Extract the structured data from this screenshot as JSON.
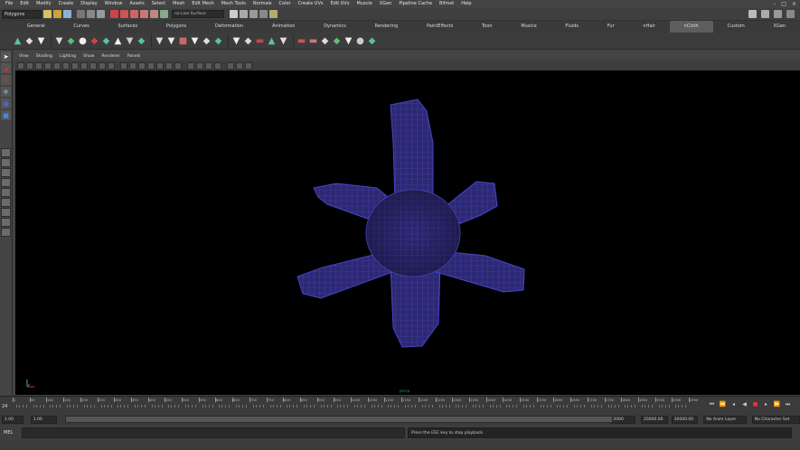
{
  "menu": {
    "items": [
      "File",
      "Edit",
      "Modify",
      "Create",
      "Display",
      "Window",
      "Assets",
      "Select",
      "Mesh",
      "Edit Mesh",
      "Mesh Tools",
      "Normals",
      "Color",
      "Create UVs",
      "Edit UVs",
      "Muscle",
      "XGen",
      "Pipeline Cache",
      "Bifrost",
      "Help"
    ],
    "window_controls": [
      "–",
      "□",
      "×"
    ]
  },
  "status_line": {
    "mode": "Polygons",
    "select_field": "no Live Surface"
  },
  "shelf_tabs": {
    "items": [
      "General",
      "Curves",
      "Surfaces",
      "Polygons",
      "Deformation",
      "Animation",
      "Dynamics",
      "Rendering",
      "PaintEffects",
      "Toon",
      "Muscle",
      "Fluids",
      "Fur",
      "nHair",
      "nCloth",
      "Custom",
      "XGen"
    ],
    "active_index": 14
  },
  "panel_menu": {
    "items": [
      "View",
      "Shading",
      "Lighting",
      "Show",
      "Renderer",
      "Panels"
    ]
  },
  "viewport": {
    "camera_label": "persp",
    "background_color": "#000000",
    "mesh_color": "#3a2f86"
  },
  "time_slider": {
    "current_frame": "24",
    "tick_labels": [
      "1",
      "50",
      "100",
      "150",
      "200",
      "250",
      "300",
      "350",
      "400",
      "450",
      "500",
      "550",
      "600",
      "650",
      "700",
      "750",
      "800",
      "850",
      "900",
      "950",
      "1000",
      "1050",
      "1100",
      "1150",
      "1200",
      "1250",
      "1300",
      "1350",
      "1400",
      "1450",
      "1500",
      "1550",
      "1600",
      "1650",
      "1700",
      "1750",
      "1800",
      "1850",
      "1900",
      "1950",
      "2000"
    ]
  },
  "range_slider": {
    "start_time": "1.00",
    "start_playback": "1.00",
    "end_playback": "2000",
    "end_time_1": "20000.00",
    "end_time_2": "30000.00",
    "anim_layer": "No Anim Layer",
    "character_set": "No Character Set"
  },
  "command_line": {
    "label": "MEL",
    "help_text": "Press the ESC key to stop playback."
  }
}
